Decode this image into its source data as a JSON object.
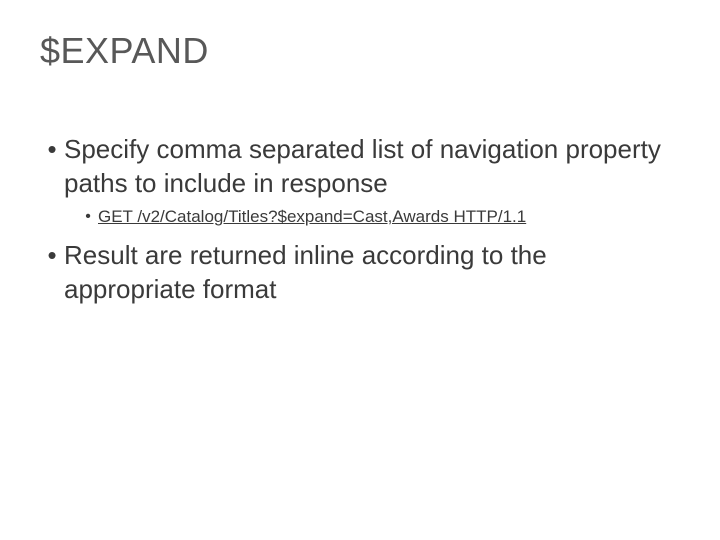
{
  "title": "$EXPAND",
  "bullets": {
    "b1": "Specify comma separated list of navigation property paths to include in response",
    "b1_sub1": "GET /v2/Catalog/Titles?$expand=Cast,Awards HTTP/1.1",
    "b2": "Result are returned inline according to the appropriate format"
  }
}
